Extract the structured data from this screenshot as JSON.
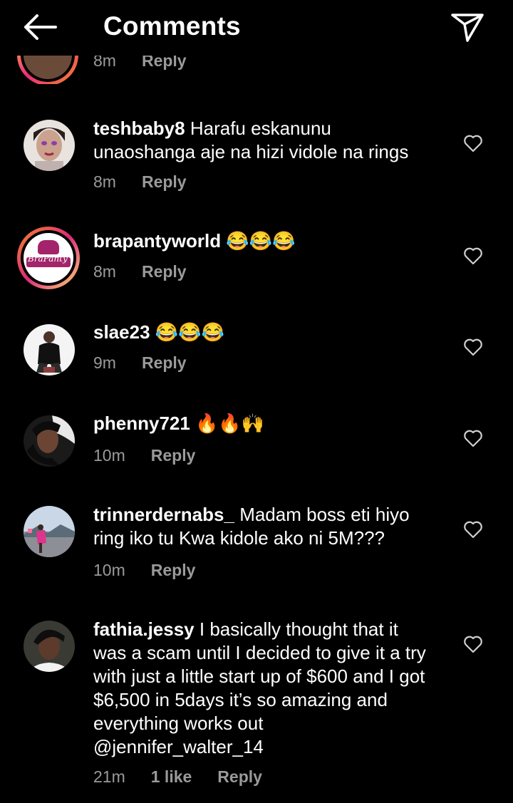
{
  "header": {
    "title": "Comments"
  },
  "partial": {
    "time": "8m",
    "reply_label": "Reply"
  },
  "comments": [
    {
      "user": "teshbaby8",
      "text": "Harafu eskanunu unaoshanga aje na hizi vidole na rings",
      "time": "8m",
      "reply_label": "Reply"
    },
    {
      "user": "brapantyworld",
      "text": "😂😂😂",
      "time": "8m",
      "reply_label": "Reply",
      "avatar_text": "BraPanty"
    },
    {
      "user": "slae23",
      "text": "😂😂😂",
      "time": "9m",
      "reply_label": "Reply"
    },
    {
      "user": "phenny721",
      "text": "🔥🔥🙌",
      "time": "10m",
      "reply_label": "Reply"
    },
    {
      "user": "trinnerdernabs_",
      "text": "Madam boss eti hiyo ring iko tu Kwa kidole ako ni 5M???",
      "time": "10m",
      "reply_label": "Reply"
    },
    {
      "user": "fathia.jessy",
      "text": "I basically thought that it was a scam until I decided to give it a try with just a little start up of $600 and I got $6,500 in 5days it’s so amazing and everything works out @jennifer_walter_14",
      "time": "21m",
      "likes": "1 like",
      "reply_label": "Reply"
    }
  ],
  "colors": {
    "background": "#000000",
    "secondary_text": "#9a9a9a",
    "story_ring": "#dd2a7b"
  },
  "icons": {
    "back": "arrow-left-icon",
    "send": "paper-plane-icon",
    "like": "heart-outline-icon"
  }
}
